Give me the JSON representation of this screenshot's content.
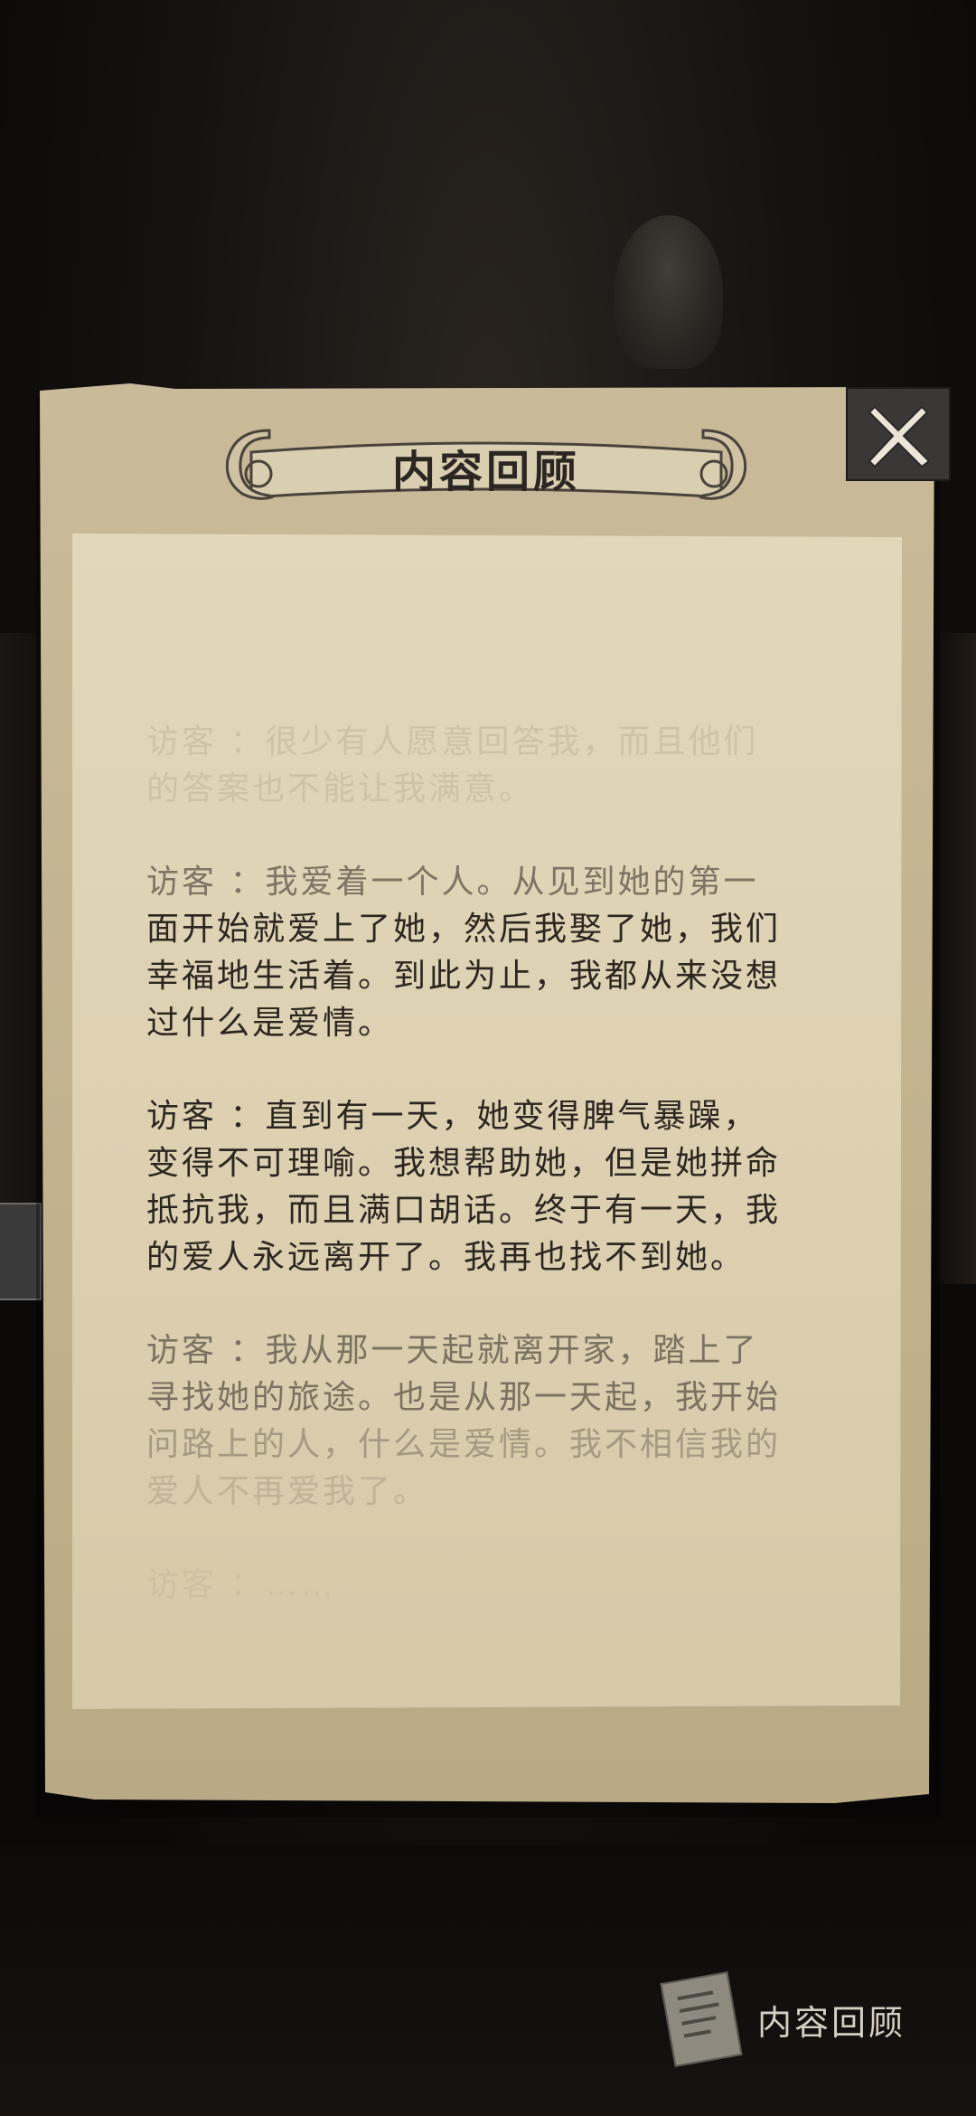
{
  "title": "内容回顾",
  "close_icon": "close-x-icon",
  "entries": [
    {
      "speaker": "访客",
      "lines": [
        "访客 ：很少有人愿意回答我，而且他们",
        "的答案也不能让我满意。"
      ]
    },
    {
      "speaker": "访客",
      "lines": [
        "访客 ：我爱着一个人。从见到她的第一",
        "面开始就爱上了她，然后我娶了她，我们",
        "幸福地生活着。到此为止，我都从来没想",
        "过什么是爱情。"
      ]
    },
    {
      "speaker": "访客",
      "lines": [
        "访客 ：直到有一天，她变得脾气暴躁，",
        "变得不可理喻。我想帮助她，但是她拼命",
        "抵抗我，而且满口胡话。终于有一天，我",
        "的爱人永远离开了。我再也找不到她。"
      ]
    },
    {
      "speaker": "访客",
      "lines": [
        "访客 ：我从那一天起就离开家，踏上了",
        "寻找她的旅途。也是从那一天起，我开始",
        "问路上的人，什么是爱情。我不相信我的",
        "爱人不再爱我了。"
      ]
    },
    {
      "speaker": "访客",
      "lines": [
        "访客 ：……"
      ]
    }
  ],
  "review_button": {
    "label": "内容回顾",
    "icon": "document-icon"
  }
}
